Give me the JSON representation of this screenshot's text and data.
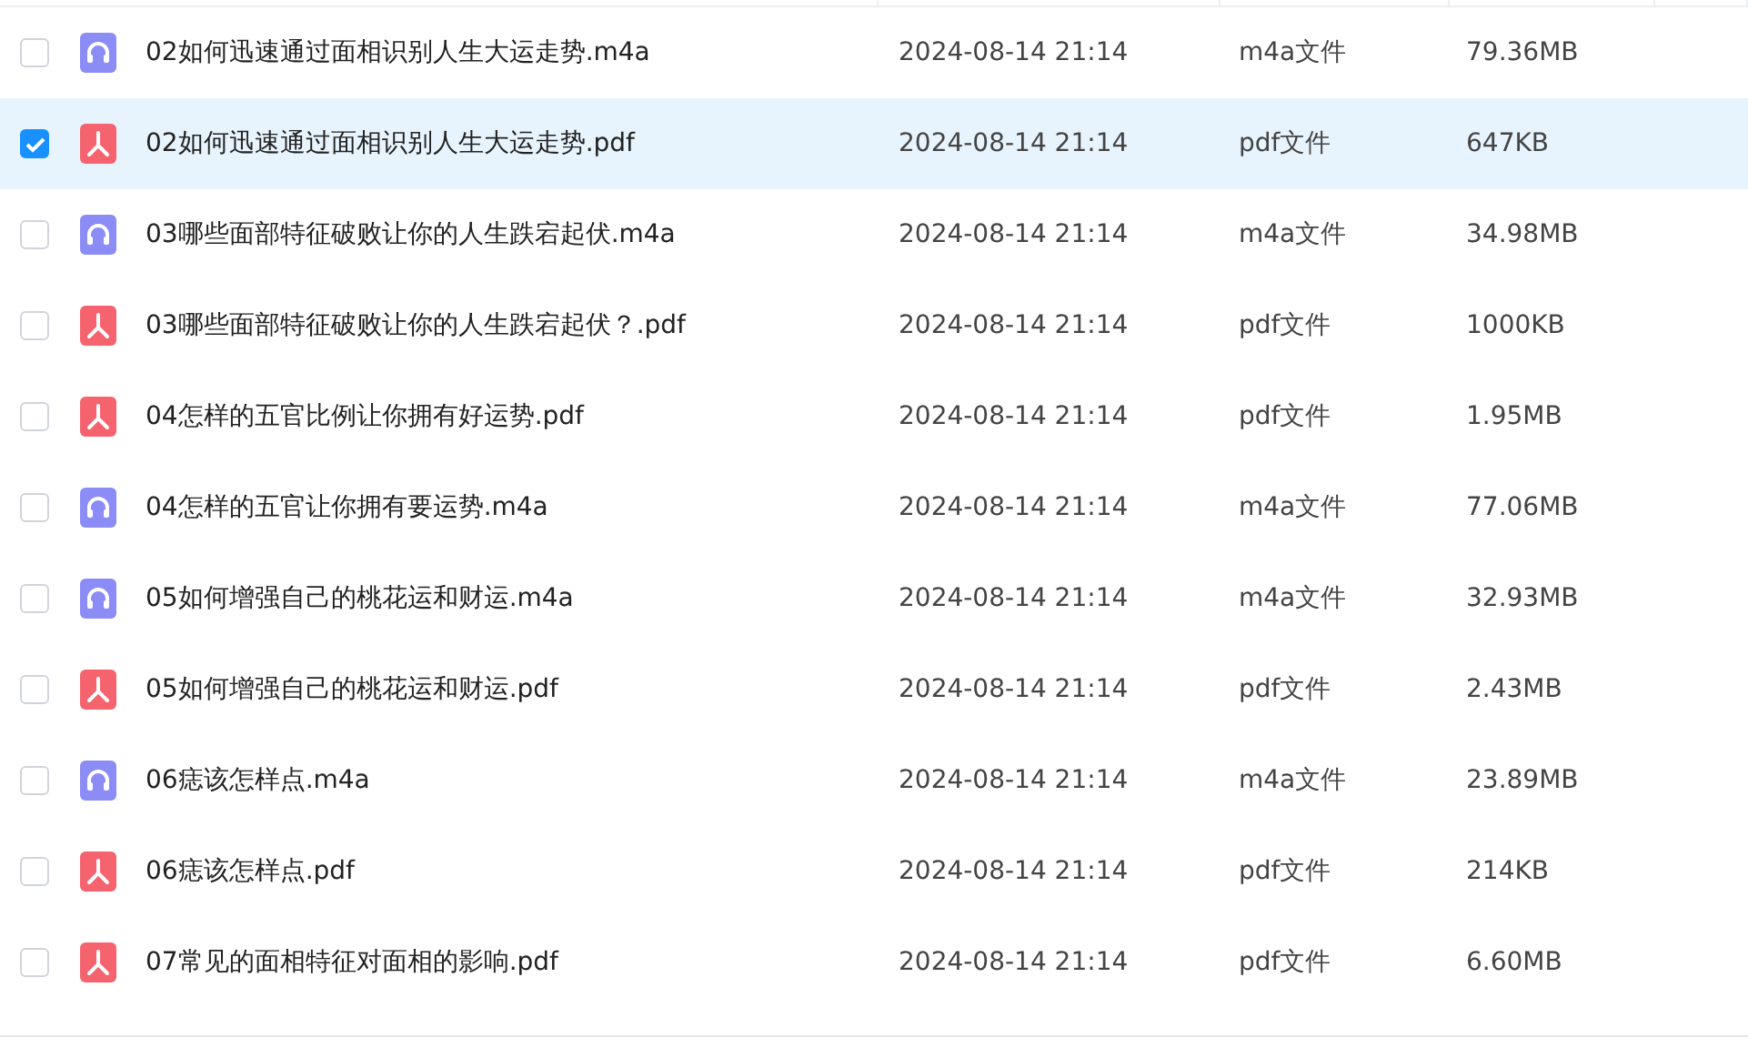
{
  "files": [
    {
      "name": "02如何迅速通过面相识别人生大运走势.m4a",
      "kind": "audio",
      "modified": "2024-08-14 21:14",
      "type": "m4a文件",
      "size": "79.36MB",
      "selected": false
    },
    {
      "name": "02如何迅速通过面相识别人生大运走势.pdf",
      "kind": "pdf",
      "modified": "2024-08-14 21:14",
      "type": "pdf文件",
      "size": "647KB",
      "selected": true
    },
    {
      "name": "03哪些面部特征破败让你的人生跌宕起伏.m4a",
      "kind": "audio",
      "modified": "2024-08-14 21:14",
      "type": "m4a文件",
      "size": "34.98MB",
      "selected": false
    },
    {
      "name": "03哪些面部特征破败让你的人生跌宕起伏？.pdf",
      "kind": "pdf",
      "modified": "2024-08-14 21:14",
      "type": "pdf文件",
      "size": "1000KB",
      "selected": false
    },
    {
      "name": "04怎样的五官比例让你拥有好运势.pdf",
      "kind": "pdf",
      "modified": "2024-08-14 21:14",
      "type": "pdf文件",
      "size": "1.95MB",
      "selected": false
    },
    {
      "name": "04怎样的五官让你拥有要运势.m4a",
      "kind": "audio",
      "modified": "2024-08-14 21:14",
      "type": "m4a文件",
      "size": "77.06MB",
      "selected": false
    },
    {
      "name": "05如何增强自己的桃花运和财运.m4a",
      "kind": "audio",
      "modified": "2024-08-14 21:14",
      "type": "m4a文件",
      "size": "32.93MB",
      "selected": false
    },
    {
      "name": "05如何增强自己的桃花运和财运.pdf",
      "kind": "pdf",
      "modified": "2024-08-14 21:14",
      "type": "pdf文件",
      "size": "2.43MB",
      "selected": false
    },
    {
      "name": "06痣该怎样点.m4a",
      "kind": "audio",
      "modified": "2024-08-14 21:14",
      "type": "m4a文件",
      "size": "23.89MB",
      "selected": false
    },
    {
      "name": "06痣该怎样点.pdf",
      "kind": "pdf",
      "modified": "2024-08-14 21:14",
      "type": "pdf文件",
      "size": "214KB",
      "selected": false
    },
    {
      "name": "07常见的面相特征对面相的影响.pdf",
      "kind": "pdf",
      "modified": "2024-08-14 21:14",
      "type": "pdf文件",
      "size": "6.60MB",
      "selected": false
    }
  ]
}
